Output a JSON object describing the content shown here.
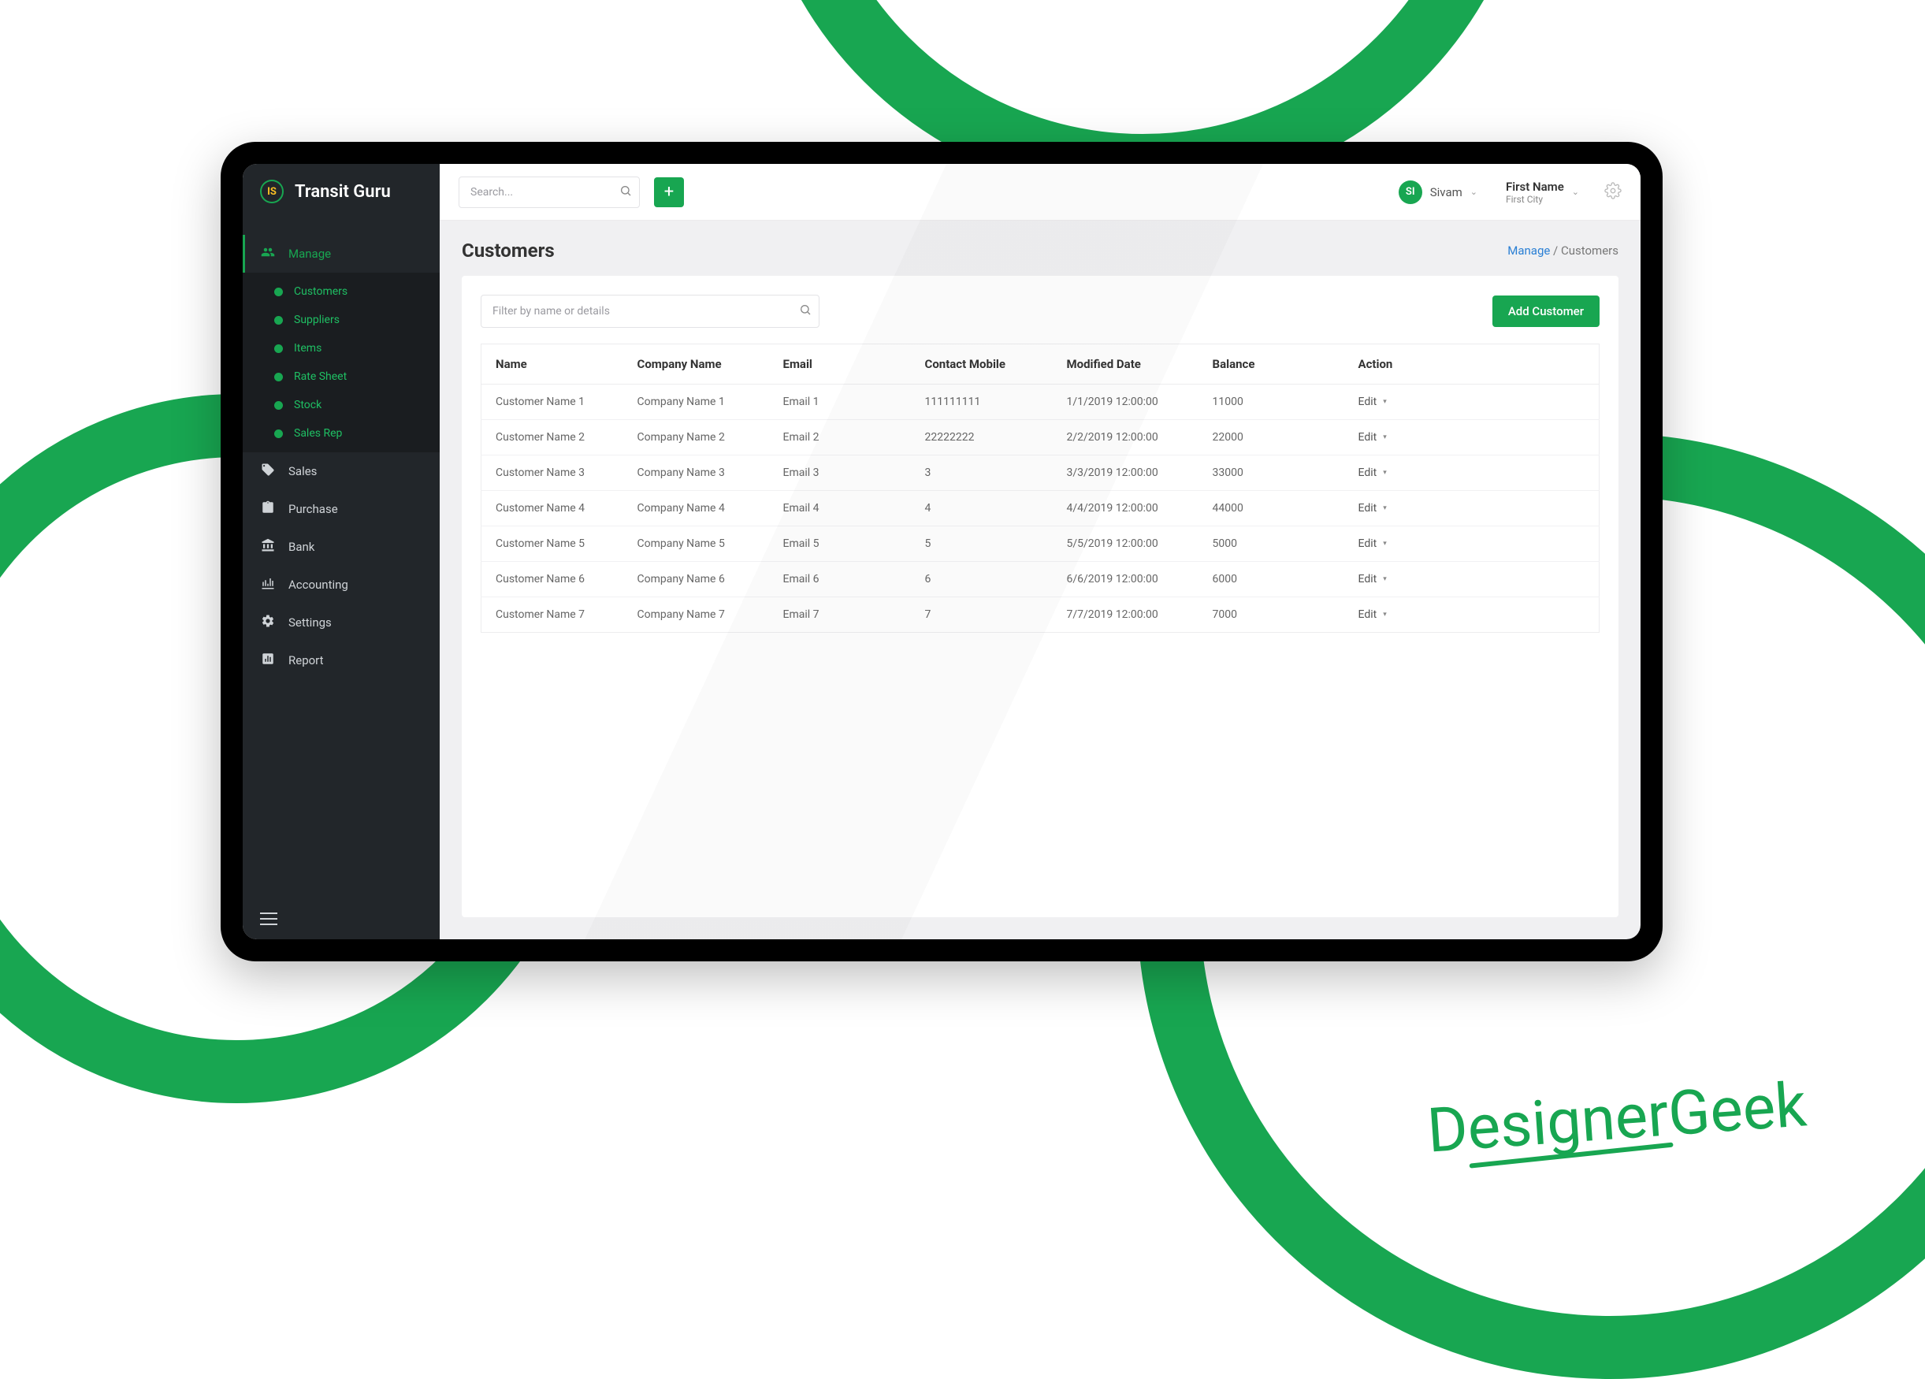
{
  "brand": {
    "logo_text": "IS",
    "app_name": "Transit Guru"
  },
  "topbar": {
    "search_placeholder": "Search...",
    "user_avatar": "SI",
    "user_name": "Sivam",
    "company_name": "First Name",
    "company_city": "First City"
  },
  "sidebar": {
    "main_items": [
      {
        "label": "Manage",
        "active": true
      },
      {
        "label": "Sales"
      },
      {
        "label": "Purchase"
      },
      {
        "label": "Bank"
      },
      {
        "label": "Accounting"
      },
      {
        "label": "Settings"
      },
      {
        "label": "Report"
      }
    ],
    "sub_items": [
      {
        "label": "Customers",
        "active": true
      },
      {
        "label": "Suppliers"
      },
      {
        "label": "Items"
      },
      {
        "label": "Rate Sheet"
      },
      {
        "label": "Stock"
      },
      {
        "label": "Sales Rep"
      }
    ]
  },
  "page": {
    "title": "Customers",
    "breadcrumb_root": "Manage",
    "breadcrumb_sep": " / ",
    "breadcrumb_current": "Customers"
  },
  "card": {
    "filter_placeholder": "Filter by name or details",
    "add_button": "Add Customer",
    "edit_label": "Edit"
  },
  "table": {
    "columns": [
      "Name",
      "Company Name",
      "Email",
      "Contact Mobile",
      "Modified Date",
      "Balance",
      "Action"
    ],
    "rows": [
      {
        "name": "Customer Name 1",
        "company": "Company Name 1",
        "email": "Email 1",
        "mobile": "111111111",
        "date": "1/1/2019 12:00:00",
        "balance": "11000"
      },
      {
        "name": "Customer Name 2",
        "company": "Company Name 2",
        "email": "Email 2",
        "mobile": "22222222",
        "date": "2/2/2019 12:00:00",
        "balance": "22000"
      },
      {
        "name": "Customer Name 3",
        "company": "Company Name 3",
        "email": "Email 3",
        "mobile": "3",
        "date": "3/3/2019 12:00:00",
        "balance": "33000"
      },
      {
        "name": "Customer Name 4",
        "company": "Company Name 4",
        "email": "Email 4",
        "mobile": "4",
        "date": "4/4/2019 12:00:00",
        "balance": "44000"
      },
      {
        "name": "Customer Name 5",
        "company": "Company Name 5",
        "email": "Email 5",
        "mobile": "5",
        "date": "5/5/2019 12:00:00",
        "balance": "5000"
      },
      {
        "name": "Customer Name 6",
        "company": "Company Name 6",
        "email": "Email 6",
        "mobile": "6",
        "date": "6/6/2019 12:00:00",
        "balance": "6000"
      },
      {
        "name": "Customer Name 7",
        "company": "Company Name 7",
        "email": "Email 7",
        "mobile": "7",
        "date": "7/7/2019 12:00:00",
        "balance": "7000"
      }
    ]
  },
  "signature": "DesignerGeek"
}
